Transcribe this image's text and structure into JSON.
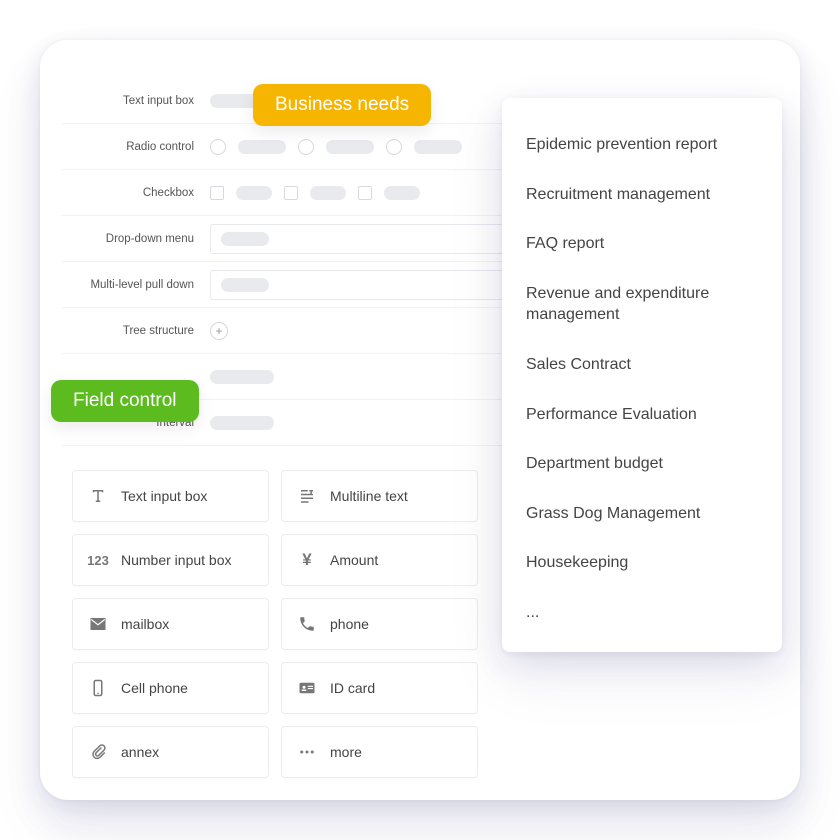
{
  "badges": {
    "business": "Business needs",
    "field": "Field control"
  },
  "form": {
    "rows": [
      {
        "label": "Text input box"
      },
      {
        "label": "Radio control"
      },
      {
        "label": "Checkbox"
      },
      {
        "label": "Drop-down menu"
      },
      {
        "label": "Multi-level pull down"
      },
      {
        "label": "Tree structure"
      },
      {
        "label": ""
      },
      {
        "label": "Interval"
      }
    ]
  },
  "menu": {
    "items": [
      "Epidemic prevention report",
      "Recruitment management",
      "FAQ report",
      "Revenue and expenditure  management",
      "Sales Contract",
      "Performance Evaluation",
      "Department budget",
      "Grass Dog Management",
      "Housekeeping",
      "..."
    ]
  },
  "fields": [
    {
      "icon": "text",
      "label": "Text input box"
    },
    {
      "icon": "multiline",
      "label": "Multiline text"
    },
    {
      "icon": "number",
      "label": "Number input box"
    },
    {
      "icon": "amount",
      "label": "Amount"
    },
    {
      "icon": "mail",
      "label": "mailbox"
    },
    {
      "icon": "phone",
      "label": "phone"
    },
    {
      "icon": "cell",
      "label": "Cell phone"
    },
    {
      "icon": "idcard",
      "label": "ID card"
    },
    {
      "icon": "annex",
      "label": "annex"
    },
    {
      "icon": "more",
      "label": "more"
    }
  ]
}
